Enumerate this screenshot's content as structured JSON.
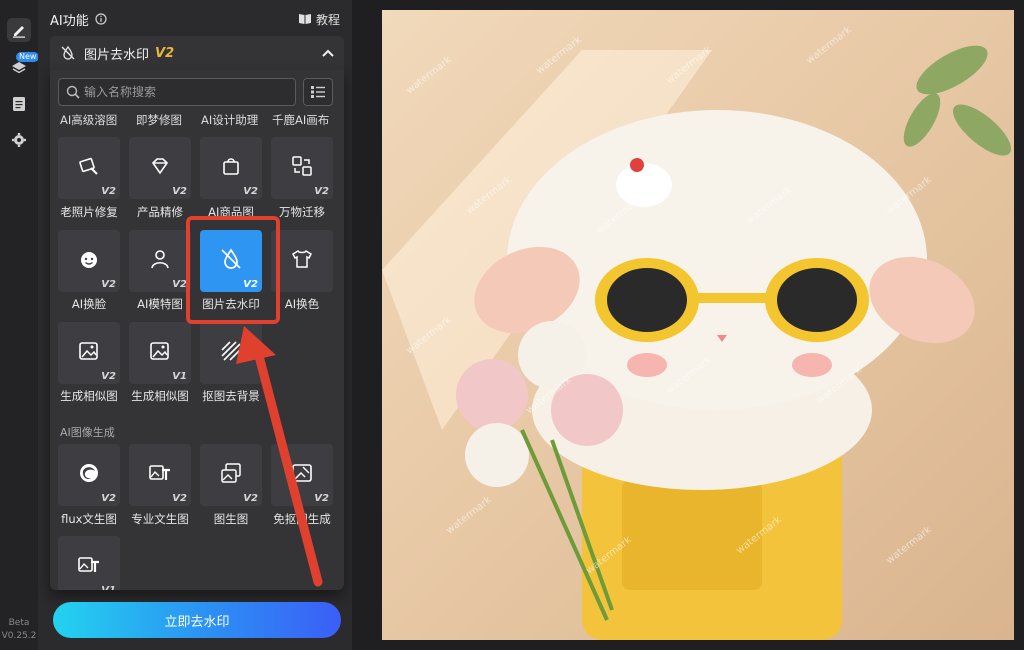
{
  "sidebar": {
    "new_badge": "New",
    "version_line1": "Beta",
    "version_line2": "V0.25.2"
  },
  "panel": {
    "title": "AI功能",
    "tutorial_label": "教程",
    "tool_name": "图片去水印",
    "tool_version": "V2"
  },
  "search": {
    "placeholder": "输入名称搜索"
  },
  "top_row": [
    "AI高级溶图",
    "即梦修图",
    "AI设计助理",
    "千鹿AI画布"
  ],
  "tiles": [
    {
      "label": "老照片修复",
      "badge": "V2",
      "icon": "photo-restore-icon"
    },
    {
      "label": "产品精修",
      "badge": "V2",
      "icon": "diamond-sparkle-icon"
    },
    {
      "label": "AI商品图",
      "badge": "V2",
      "icon": "shopping-bag-icon"
    },
    {
      "label": "万物迁移",
      "badge": "V2",
      "icon": "image-transfer-icon"
    },
    {
      "label": "AI换脸",
      "badge": "V2",
      "icon": "face-swap-icon"
    },
    {
      "label": "AI模特图",
      "badge": "V2",
      "icon": "model-person-icon"
    },
    {
      "label": "图片去水印",
      "badge": "V2",
      "icon": "watermark-remove-icon"
    },
    {
      "label": "AI换色",
      "badge": "",
      "icon": "tshirt-color-icon"
    },
    {
      "label": "生成相似图",
      "badge": "V2",
      "icon": "similar-image-icon"
    },
    {
      "label": "生成相似图",
      "badge": "V1",
      "icon": "similar-image-icon"
    },
    {
      "label": "抠图去背景",
      "badge": "",
      "icon": "cutout-icon"
    },
    {
      "label": "flux文生图",
      "badge": "V2",
      "icon": "flux-swirl-icon"
    },
    {
      "label": "专业文生图",
      "badge": "V2",
      "icon": "text-to-image-icon"
    },
    {
      "label": "图生图",
      "badge": "V2",
      "icon": "image-to-image-icon"
    },
    {
      "label": "免抠图生成",
      "badge": "V2",
      "icon": "no-cutout-icon"
    },
    {
      "label": "",
      "badge": "V1",
      "icon": "text-to-image-icon"
    }
  ],
  "section_label": "AI图像生成",
  "cta": {
    "label": "立即去水印"
  },
  "canvas": {
    "watermark_text": "watermark"
  },
  "colors": {
    "accent": "#2f95f3",
    "highlight": "#e0412e",
    "version_gold": "#e8b73b"
  }
}
